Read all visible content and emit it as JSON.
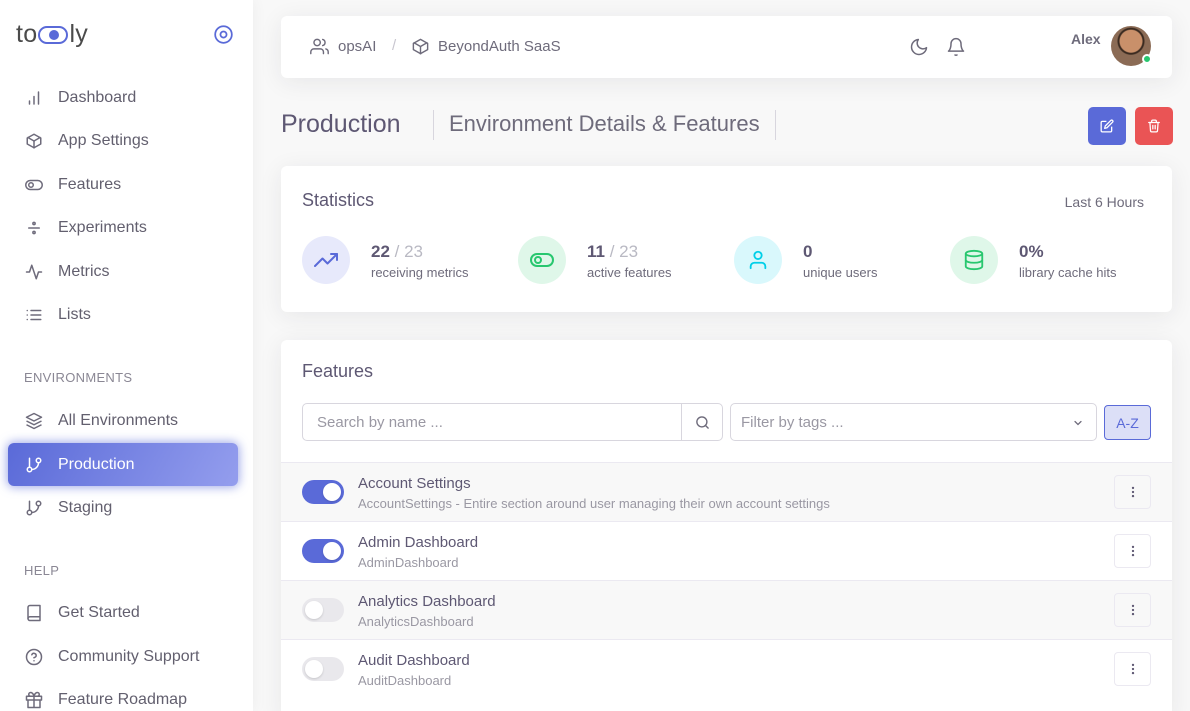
{
  "brand": {
    "before": "to",
    "after": "ly"
  },
  "sidebar": {
    "items": [
      {
        "label": "Dashboard",
        "icon": "bar-chart-icon"
      },
      {
        "label": "App Settings",
        "icon": "box-icon"
      },
      {
        "label": "Features",
        "icon": "toggle-icon"
      },
      {
        "label": "Experiments",
        "icon": "divide-icon"
      },
      {
        "label": "Metrics",
        "icon": "activity-icon"
      },
      {
        "label": "Lists",
        "icon": "list-icon"
      }
    ],
    "environments_title": "ENVIRONMENTS",
    "environments": [
      {
        "label": "All Environments",
        "icon": "layers-icon"
      },
      {
        "label": "Production",
        "icon": "git-branch-icon",
        "active": true
      },
      {
        "label": "Staging",
        "icon": "git-branch-icon"
      }
    ],
    "help_title": "HELP",
    "help": [
      {
        "label": "Get Started",
        "icon": "book-icon"
      },
      {
        "label": "Community Support",
        "icon": "help-circle-icon"
      },
      {
        "label": "Feature Roadmap",
        "icon": "gift-icon"
      }
    ]
  },
  "header": {
    "org": "opsAI",
    "app": "BeyondAuth SaaS",
    "separator": "/",
    "user_name": "Alex"
  },
  "page": {
    "title": "Production",
    "subtitle": "Environment Details & Features"
  },
  "statistics": {
    "title": "Statistics",
    "range": "Last 6 Hours",
    "items": [
      {
        "value": "22",
        "total": " / 23",
        "label": "receiving metrics",
        "color": "#5a6ad8"
      },
      {
        "value": "11",
        "total": " / 23",
        "label": "active features",
        "color": "#28c76f"
      },
      {
        "value": "0",
        "total": "",
        "label": "unique users",
        "color": "#00cfe8"
      },
      {
        "value": "0%",
        "total": "",
        "label": "library cache hits",
        "color": "#28c76f"
      }
    ]
  },
  "features": {
    "title": "Features",
    "search_placeholder": "Search by name ...",
    "tags_placeholder": "Filter by tags ...",
    "sort_label": "A-Z",
    "rows": [
      {
        "name": "Account Settings",
        "key": "AccountSettings  -  Entire section around user managing their own account settings",
        "enabled": true
      },
      {
        "name": "Admin Dashboard",
        "key": "AdminDashboard",
        "enabled": true
      },
      {
        "name": "Analytics Dashboard",
        "key": "AnalyticsDashboard",
        "enabled": false
      },
      {
        "name": "Audit Dashboard",
        "key": "AuditDashboard",
        "enabled": false
      }
    ]
  },
  "colors": {
    "primary": "#5a6ad8",
    "danger": "#ea5455",
    "success": "#28c76f",
    "info": "#00cfe8"
  }
}
